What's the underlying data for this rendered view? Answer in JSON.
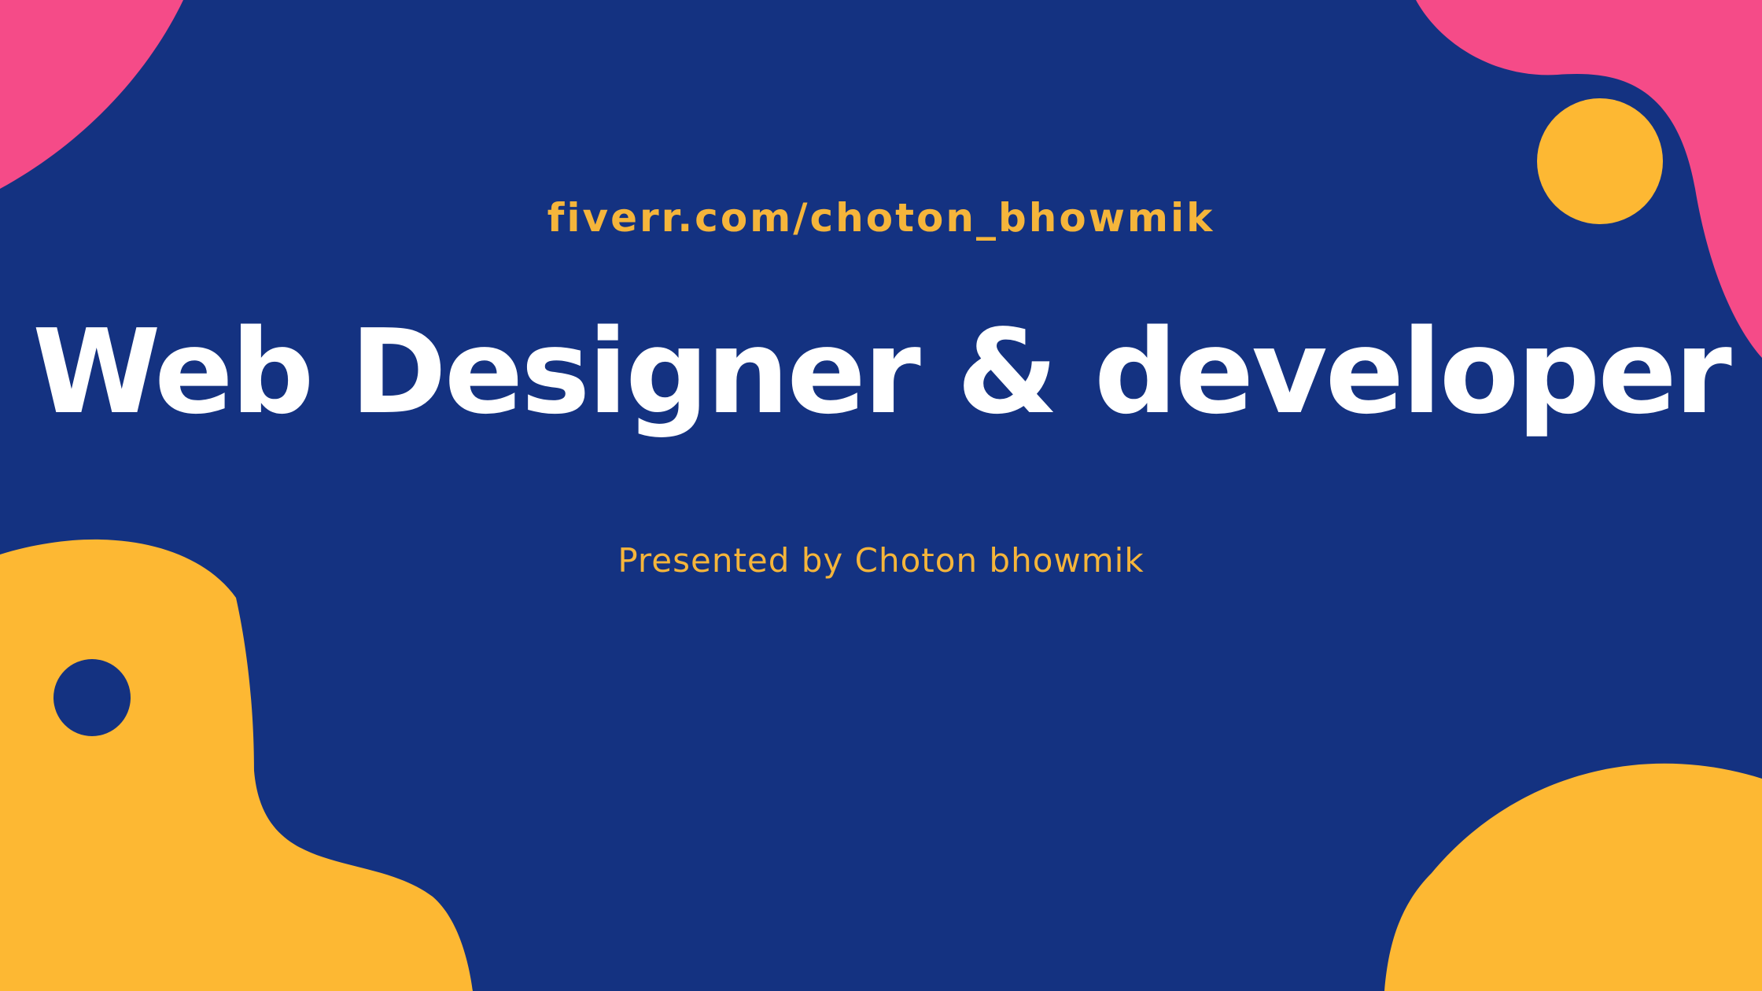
{
  "slide": {
    "url_text": "fiverr.com/choton_bhowmik",
    "title": "Web Designer & developer",
    "subtitle": "Presented by Choton bhowmik"
  },
  "colors": {
    "background": "#143281",
    "accent_text": "#F5B53B",
    "title_text": "#FFFFFF",
    "pink_blob": "#F54B88",
    "yellow_blob": "#FDB833"
  }
}
